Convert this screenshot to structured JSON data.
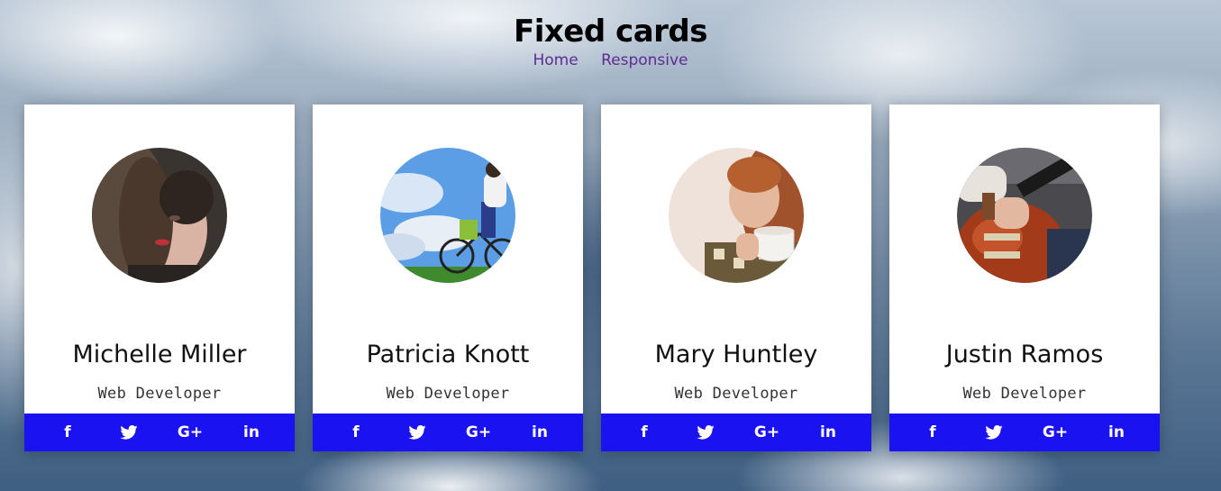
{
  "header": {
    "title": "Fixed cards",
    "nav": [
      {
        "label": "Home"
      },
      {
        "label": "Responsive"
      }
    ]
  },
  "cards": [
    {
      "name": "Michelle Miller",
      "role": "Web Developer"
    },
    {
      "name": "Patricia Knott",
      "role": "Web Developer"
    },
    {
      "name": "Mary Huntley",
      "role": "Web Developer"
    },
    {
      "name": "Justin Ramos",
      "role": "Web Developer"
    }
  ],
  "social": {
    "icons": [
      "facebook-icon",
      "twitter-icon",
      "google-plus-icon",
      "linkedin-icon"
    ],
    "glyphs": {
      "facebook": "f",
      "google_plus": "G+",
      "linkedin": "in"
    }
  },
  "colors": {
    "social_bar": "#1a12f0",
    "nav_link": "#5c2d91",
    "card_bg": "#ffffff"
  }
}
